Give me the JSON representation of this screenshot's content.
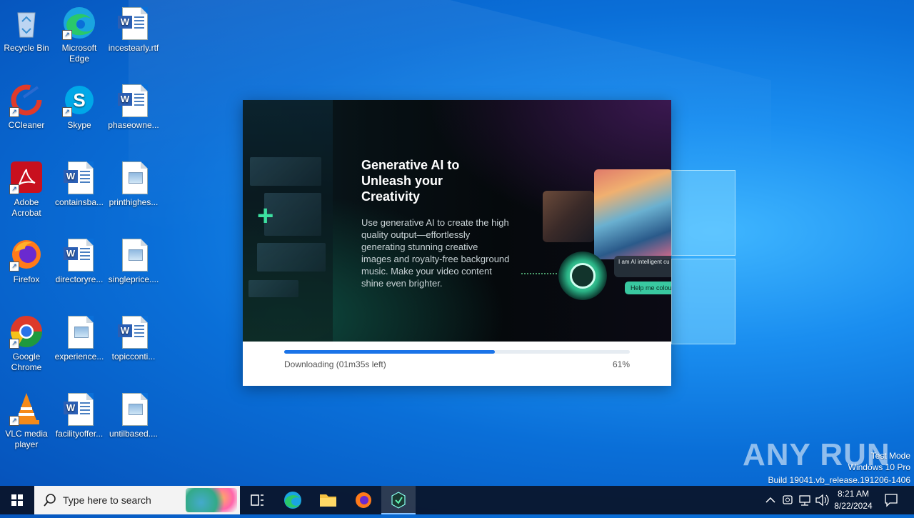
{
  "desktop": {
    "icons": [
      {
        "label": "Recycle Bin",
        "icon": "recycle-bin-icon"
      },
      {
        "label": "Microsoft Edge",
        "icon": "edge-icon"
      },
      {
        "label": "incestearly.rtf",
        "icon": "word-doc-icon"
      },
      {
        "label": "CCleaner",
        "icon": "ccleaner-icon"
      },
      {
        "label": "Skype",
        "icon": "skype-icon"
      },
      {
        "label": "phaseowne...",
        "icon": "word-doc-icon"
      },
      {
        "label": "Adobe Acrobat",
        "icon": "acrobat-icon"
      },
      {
        "label": "containsba...",
        "icon": "word-doc-icon"
      },
      {
        "label": "printhighes...",
        "icon": "image-file-icon"
      },
      {
        "label": "Firefox",
        "icon": "firefox-icon"
      },
      {
        "label": "directoryre...",
        "icon": "word-doc-icon"
      },
      {
        "label": "singleprice....",
        "icon": "image-file-icon"
      },
      {
        "label": "Google Chrome",
        "icon": "chrome-icon"
      },
      {
        "label": "experience...",
        "icon": "image-file-icon"
      },
      {
        "label": "topicconti...",
        "icon": "word-doc-icon"
      },
      {
        "label": "VLC media player",
        "icon": "vlc-icon"
      },
      {
        "label": "facilityoffer...",
        "icon": "word-doc-icon"
      },
      {
        "label": "untilbased....",
        "icon": "image-file-icon"
      }
    ]
  },
  "installer": {
    "hero_title": "Generative AI to Unleash your Creativity",
    "hero_description": "Use generative AI to create the high quality output—effortlessly generating stunning creative images and royalty-free background music. Make your video content shine even brighter.",
    "chat_bubble": "I am AI intelligent cu how can I help you ?",
    "help_button": "Help me colour",
    "status": "Downloading (01m35s left)",
    "percent_text": "61%",
    "progress": 0.61,
    "accent_color": "#1a73e8"
  },
  "watermark": {
    "logo": "ANY RUN",
    "line1": "Test Mode",
    "line2": "Windows 10 Pro",
    "line3": "Build 19041.vb_release.191206-1406"
  },
  "taskbar": {
    "search_placeholder": "Type here to search",
    "time": "8:21 AM",
    "date": "8/22/2024",
    "pinned": [
      "task-view-icon",
      "edge-icon",
      "file-explorer-icon",
      "firefox-icon",
      "installer-icon"
    ]
  }
}
